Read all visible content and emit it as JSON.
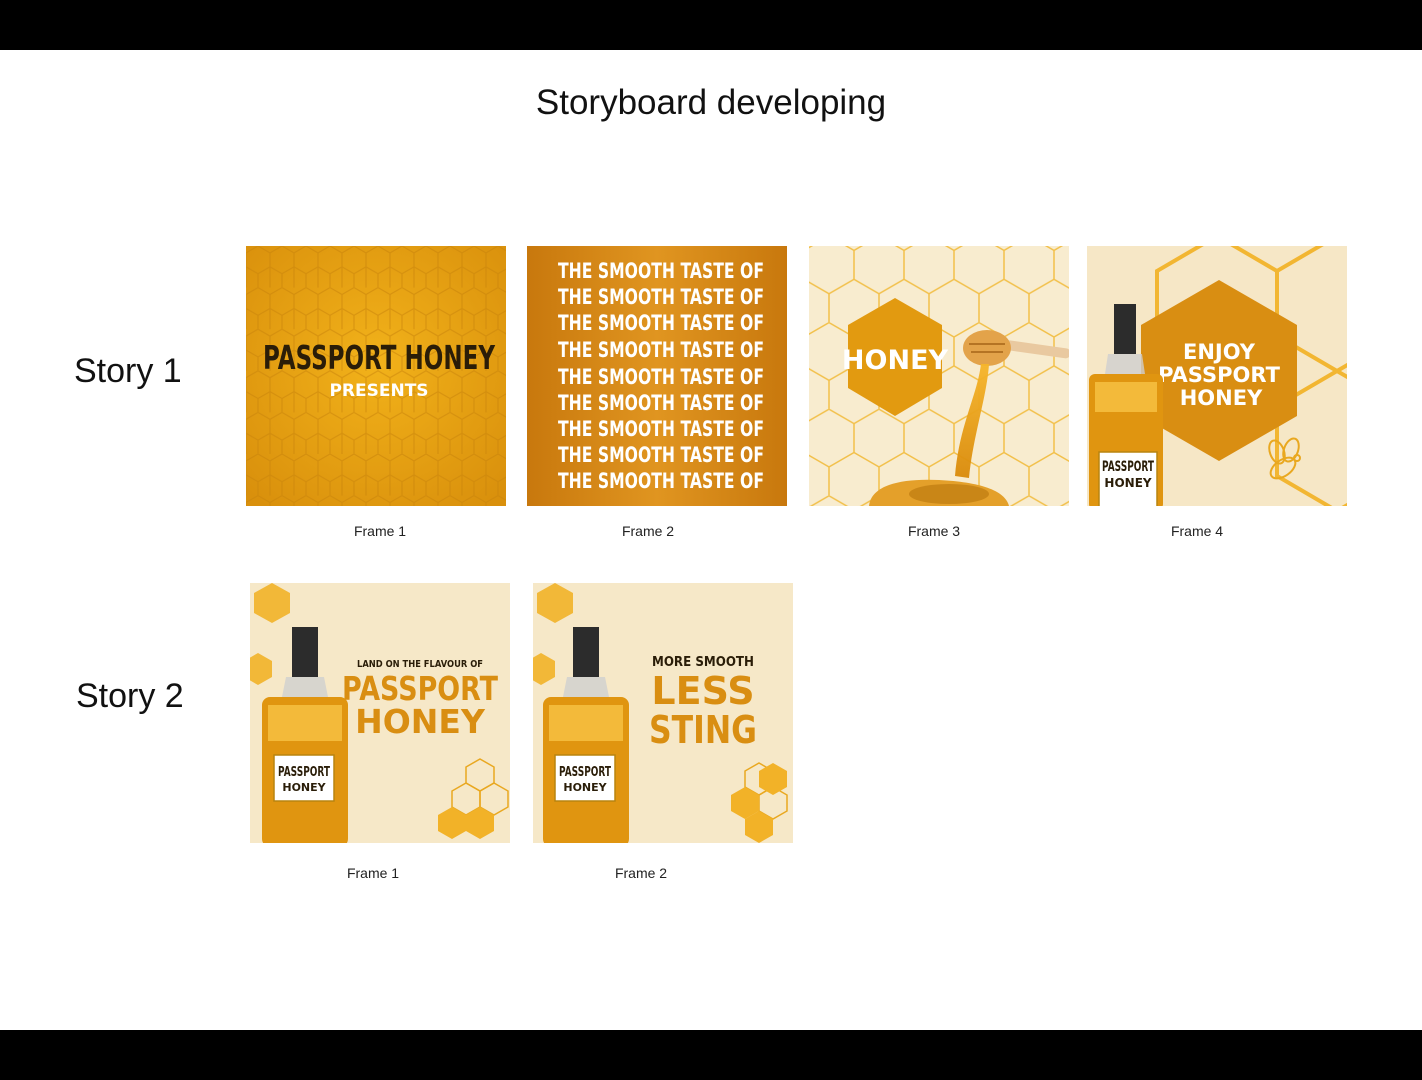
{
  "title": "Storyboard developing",
  "colors": {
    "honey": "#E8A512",
    "amber": "#C97A10",
    "dark": "#2A1D08",
    "cream": "#F6E9CA",
    "white": "#FFFFFF"
  },
  "stories": [
    {
      "label": "Story 1",
      "frames": [
        {
          "caption": "Frame 1",
          "headline": "PASSPORT HONEY",
          "sub": "PRESENTS"
        },
        {
          "caption": "Frame 2",
          "repeat_line": "THE SMOOTH TASTE OF"
        },
        {
          "caption": "Frame 3",
          "hex_text": "HONEY"
        },
        {
          "caption": "Frame 4",
          "line1": "ENJOY",
          "line2": "PASSPORT",
          "line3": "HONEY",
          "label_top": "PASSPORT",
          "label_bottom": "HONEY"
        }
      ]
    },
    {
      "label": "Story 2",
      "frames": [
        {
          "caption": "Frame 1",
          "small": "LAND ON THE FLAVOUR OF",
          "big1": "PASSPORT",
          "big2": "HONEY",
          "label_top": "PASSPORT",
          "label_bottom": "HONEY"
        },
        {
          "caption": "Frame 2",
          "small": "MORE SMOOTH",
          "big1": "LESS",
          "big2": "STING",
          "label_top": "PASSPORT",
          "label_bottom": "HONEY"
        }
      ]
    }
  ]
}
